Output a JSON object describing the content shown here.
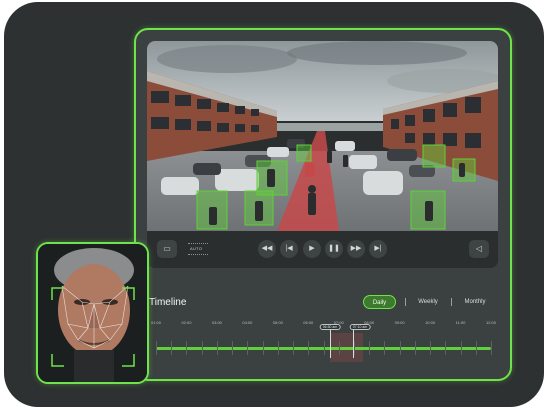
{
  "player": {
    "auto_label": "AUTO"
  },
  "controls": {
    "rewind": "◀◀",
    "previous": "|◀",
    "play": "▶",
    "pause": "❚❚",
    "forward": "▶▶",
    "next": "▶|"
  },
  "timeline": {
    "title": "Timeline",
    "tabs": [
      "Daily",
      "Weekly",
      "Monthly"
    ],
    "active_tab": "Daily",
    "ticks": [
      "01:00",
      "02:00",
      "03:00",
      "04:00",
      "05:00",
      "06:00",
      "07:00",
      "08:00",
      "09:00",
      "10:00",
      "11:00",
      "12:00"
    ],
    "marker_start": "06:50 am",
    "marker_end": "07:10 am"
  },
  "colors": {
    "accent": "#6fe34a",
    "panel": "#3b4140",
    "background": "#2d3131"
  }
}
